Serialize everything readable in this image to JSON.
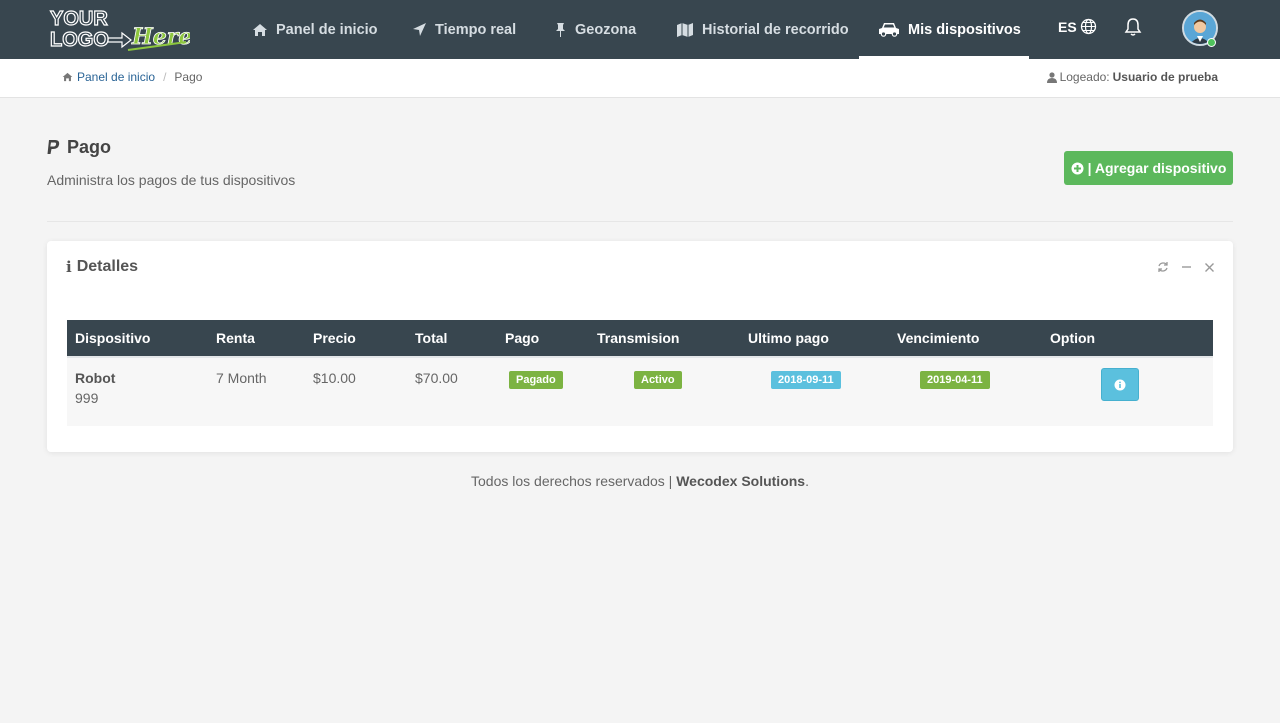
{
  "nav": {
    "items": [
      {
        "label": "Panel de inicio",
        "icon": "home-icon"
      },
      {
        "label": "Tiempo real",
        "icon": "location-arrow-icon"
      },
      {
        "label": "Geozona",
        "icon": "pin-icon"
      },
      {
        "label": "Historial de recorrido",
        "icon": "map-icon"
      },
      {
        "label": "Mis dispositivos",
        "icon": "car-icon"
      }
    ],
    "lang": "ES"
  },
  "logo": {
    "line1": "YOUR",
    "line2": "LOGO",
    "script": "Here"
  },
  "breadcrumb": {
    "home": "Panel de inicio",
    "separator": "/",
    "current": "Pago"
  },
  "logged": {
    "label": "Logeado:",
    "user": "Usuario de prueba"
  },
  "page": {
    "title": "Pago",
    "subtitle": "Administra los pagos de tus dispositivos",
    "add_button": "| Agregar dispositivo"
  },
  "panel": {
    "title": "Detalles",
    "table": {
      "headers": [
        "Dispositivo",
        "Renta",
        "Precio",
        "Total",
        "Pago",
        "Transmision",
        "Ultimo pago",
        "Vencimiento",
        "Option"
      ],
      "rows": [
        {
          "device_name": "Robot",
          "device_id": "999",
          "renta": "7 Month",
          "precio": "$10.00",
          "total": "$70.00",
          "pago": "Pagado",
          "transmision": "Activo",
          "ultimo_pago": "2018-09-11",
          "vencimiento": "2019-04-11"
        }
      ]
    }
  },
  "footer": {
    "text": "Todos los derechos reservados |",
    "company": "Wecodex Solutions",
    "end": "."
  },
  "colors": {
    "nav_bg": "#38464f",
    "success": "#5cb85c",
    "info": "#5bc0de",
    "badge_green": "#7cb342"
  }
}
